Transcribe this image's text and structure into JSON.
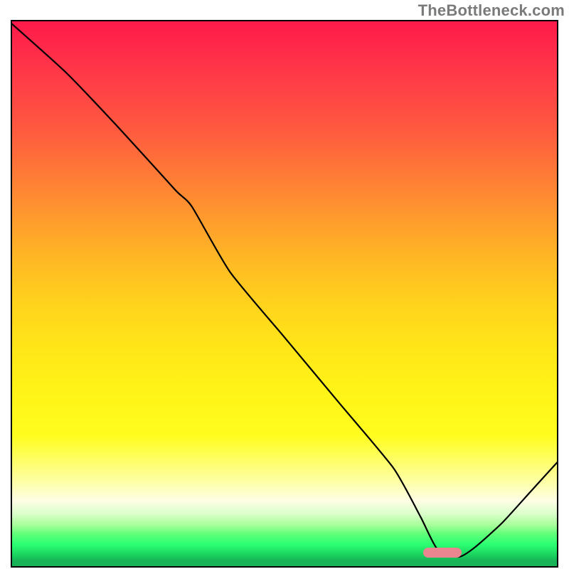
{
  "watermark": "TheBottleneck.com",
  "chart_data": {
    "type": "line",
    "title": "",
    "xlabel": "",
    "ylabel": "",
    "xlim": [
      0,
      100
    ],
    "ylim": [
      0,
      100
    ],
    "grid": false,
    "legend": false,
    "series": [
      {
        "name": "curve",
        "x": [
          0,
          10,
          20,
          30,
          33,
          40,
          50,
          60,
          70,
          75,
          78,
          82,
          85,
          90,
          95,
          100
        ],
        "y": [
          99.5,
          90.5,
          80,
          69,
          66,
          54,
          42,
          30,
          18,
          9,
          3.2,
          1.7,
          3.5,
          8,
          13.5,
          19
        ]
      }
    ],
    "markers": [
      {
        "name": "optimal-marker",
        "shape": "pill",
        "x_center": 79,
        "y_center": 2.5,
        "width_pct": 7,
        "height_pct": 1.8,
        "color": "#e98690"
      }
    ],
    "background_gradient": {
      "top": "#ff1a4b",
      "mid": "#ffe618",
      "bottom": "#17b356"
    }
  }
}
